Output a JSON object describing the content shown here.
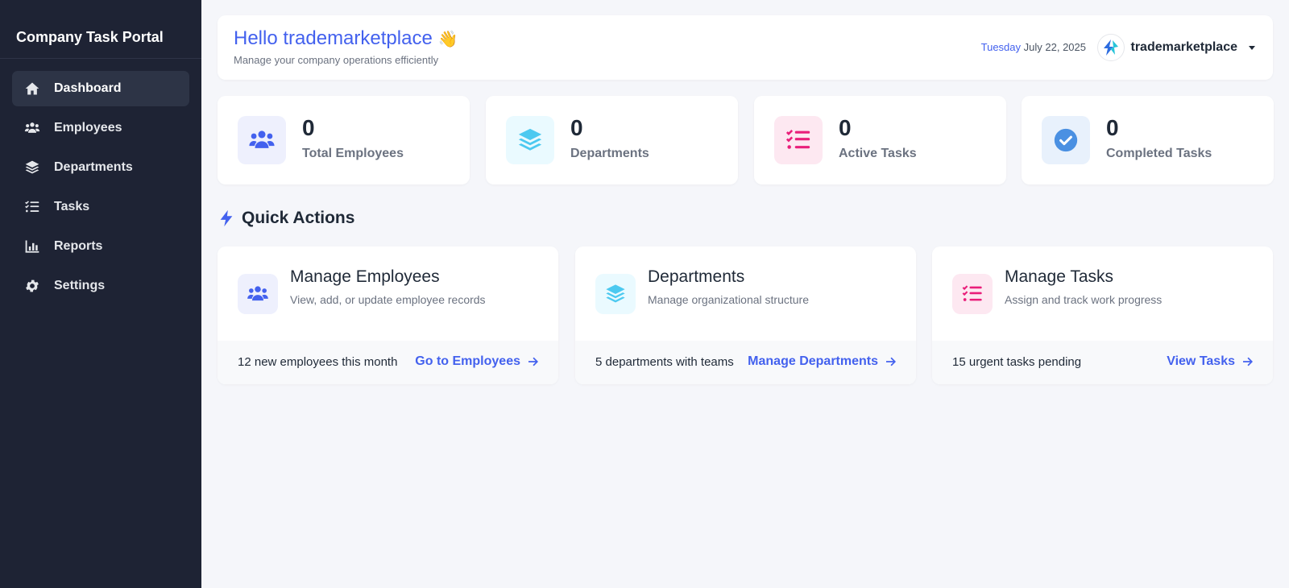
{
  "sidebar": {
    "brand": "Company Task Portal",
    "items": [
      {
        "label": "Dashboard",
        "icon": "home-icon"
      },
      {
        "label": "Employees",
        "icon": "users-icon"
      },
      {
        "label": "Departments",
        "icon": "layers-icon"
      },
      {
        "label": "Tasks",
        "icon": "tasks-icon"
      },
      {
        "label": "Reports",
        "icon": "chart-icon"
      },
      {
        "label": "Settings",
        "icon": "gear-icon"
      }
    ],
    "active": "Dashboard"
  },
  "header": {
    "greeting": "Hello trademarketplace",
    "wave": "👋",
    "subtitle": "Manage your company operations efficiently",
    "day": "Tuesday",
    "date": "July 22, 2025",
    "username": "trademarketplace"
  },
  "stats": [
    {
      "value": "0",
      "label": "Total Employees",
      "icon": "users-icon",
      "color": "#4361ee",
      "bg": "#eef0fd"
    },
    {
      "value": "0",
      "label": "Departments",
      "icon": "layers-icon",
      "color": "#4cc9f0",
      "bg": "#eafaff"
    },
    {
      "value": "0",
      "label": "Active Tasks",
      "icon": "tasks-icon",
      "color": "#e91e7a",
      "bg": "#fde8f1"
    },
    {
      "value": "0",
      "label": "Completed Tasks",
      "icon": "check-circle-icon",
      "color": "#4a90e2",
      "bg": "#e8f1fc"
    }
  ],
  "quick_actions": {
    "title": "Quick Actions",
    "cards": [
      {
        "title": "Manage Employees",
        "desc": "View, add, or update employee records",
        "footer": "12 new employees this month",
        "link": "Go to Employees",
        "icon": "users-icon"
      },
      {
        "title": "Departments",
        "desc": "Manage organizational structure",
        "footer": "5 departments with teams",
        "link": "Manage Departments",
        "icon": "layers-icon"
      },
      {
        "title": "Manage Tasks",
        "desc": "Assign and track work progress",
        "footer": "15 urgent tasks pending",
        "link": "View Tasks",
        "icon": "tasks-icon"
      }
    ]
  },
  "colors": {
    "sidebar_bg": "#1e2334",
    "accent": "#4361ee",
    "page_bg": "#f5f6fa"
  }
}
